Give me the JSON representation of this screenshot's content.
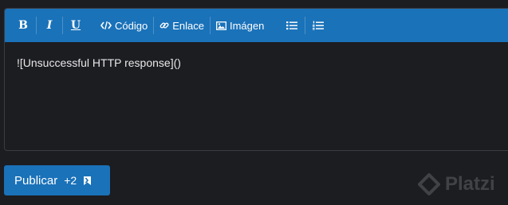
{
  "toolbar": {
    "bold_label": "B",
    "italic_label": "I",
    "underline_label": "U",
    "code_label": "Código",
    "link_label": "Enlace",
    "image_label": "Imágen"
  },
  "editor": {
    "content": "![Unsuccessful HTTP response]()"
  },
  "publish": {
    "label": "Publicar",
    "points": "+2"
  },
  "watermark": {
    "text": "Platzi"
  },
  "colors": {
    "accent": "#1a72b9",
    "background": "#1c1d21",
    "text": "#e8e8ea"
  },
  "icons": {
    "code": "code-icon",
    "link": "link-icon",
    "image": "image-icon",
    "bullet_list": "bullet-list-icon",
    "numbered_list": "numbered-list-icon",
    "publish": "points-flag-icon",
    "watermark": "platzi-logo-icon"
  }
}
